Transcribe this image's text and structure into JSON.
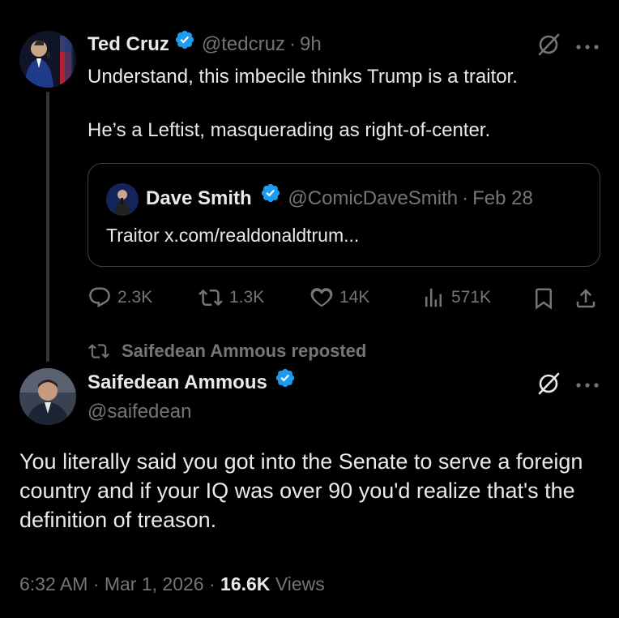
{
  "tweet1": {
    "author_name": "Ted Cruz",
    "handle": "@tedcruz",
    "separator": "·",
    "time": "9h",
    "body_line1": "Understand, this imbecile thinks Trump is a traitor.",
    "body_line2": "He’s a Leftist, masquerading as right-of-center.",
    "quote": {
      "author_name": "Dave Smith",
      "handle": "@ComicDaveSmith",
      "separator": "·",
      "date": "Feb 28",
      "text": "Traitor x.com/realdonaldtrum..."
    },
    "actions": {
      "replies": "2.3K",
      "reposts": "1.3K",
      "likes": "14K",
      "views": "571K"
    }
  },
  "repost_label": "Saifedean Ammous reposted",
  "tweet2": {
    "author_name": "Saifedean Ammous",
    "handle": "@saifedean",
    "body": "You literally said you got into the Senate to serve a foreign country and if your IQ was over 90 you'd realize that's the definition of treason.",
    "time": "6:32 AM",
    "separator": "·",
    "date": "Mar 1, 2026",
    "views_count": "16.6K",
    "views_label": "Views"
  },
  "colors": {
    "background": "#000000",
    "text": "#e7e9ea",
    "muted": "#71767b",
    "verified": "#1d9bf0"
  },
  "icons": [
    "verified-badge-icon",
    "grok-icon",
    "more-icon",
    "reply-icon",
    "repost-icon",
    "like-icon",
    "views-icon",
    "bookmark-icon",
    "share-icon"
  ]
}
